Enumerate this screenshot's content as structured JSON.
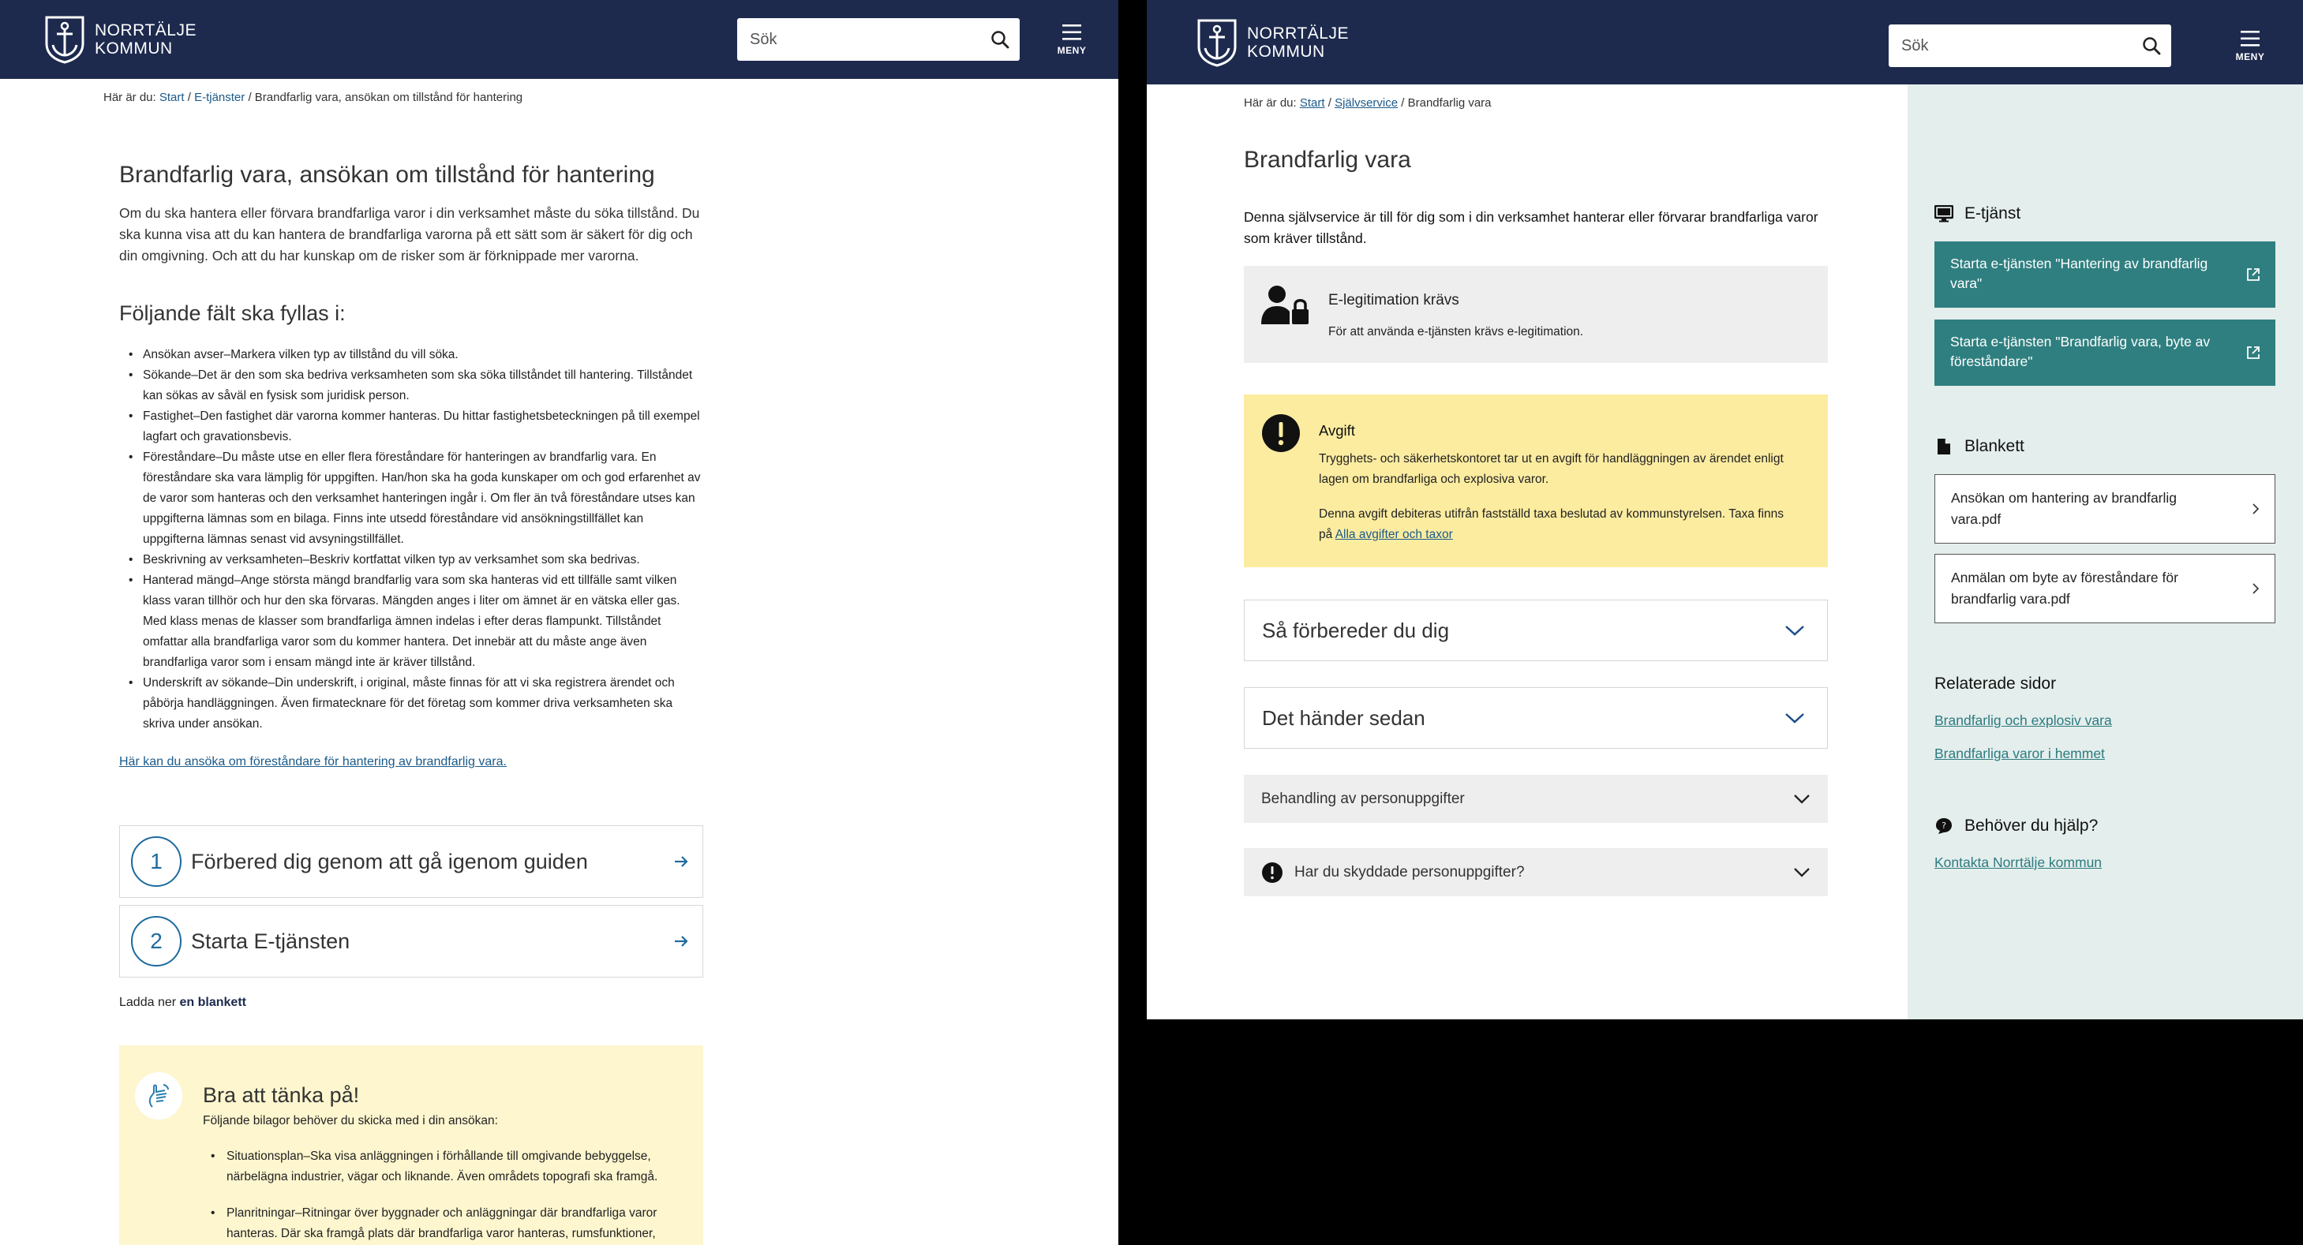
{
  "brand": {
    "line1": "NORRTÄLJE",
    "line2": "KOMMUN"
  },
  "search": {
    "placeholder": "Sök"
  },
  "menu": {
    "label": "MENY"
  },
  "left": {
    "breadcrumb": {
      "prefix": "Här är du:",
      "items": [
        "Start",
        "E-tjänster"
      ],
      "current": "Brandfarlig vara, ansökan om tillstånd för hantering"
    },
    "title": "Brandfarlig vara, ansökan om tillstånd för hantering",
    "intro": "Om du ska hantera eller förvara brandfarliga varor i din verksamhet måste du söka tillstånd. Du ska kunna visa att du kan hantera de brandfarliga varorna på ett sätt som är säkert för dig och din omgivning. Och att du har kunskap om de risker som är förknippade mer varorna.",
    "fields_heading": "Följande fält ska fyllas i:",
    "fields": [
      "Ansökan avser–Markera vilken typ av tillstånd du vill söka.",
      "Sökande–Det är den som ska bedriva verksamheten som ska söka tillståndet till hantering. Tillståndet kan sökas av såväl en fysisk som juridisk person.",
      "Fastighet–Den fastighet där varorna kommer hanteras. Du hittar fastighetsbeteckningen på till exempel lagfart och gravationsbevis.",
      "Föreståndare–Du måste utse en eller flera föreståndare för hanteringen av brandfarlig vara. En föreståndare ska vara lämplig för uppgiften. Han/hon ska ha goda kunskaper om och god erfarenhet av de varor som hanteras och den verksamhet hanteringen ingår i. Om fler än två föreståndare utses kan uppgifterna lämnas som en bilaga. Finns inte utsedd föreståndare vid ansökningstillfället kan uppgifterna lämnas senast vid avsyningstillfället.",
      "Beskrivning av verksamheten–Beskriv kortfattat vilken typ av verksamhet som ska bedrivas.",
      "Hanterad mängd–Ange största mängd brandfarlig vara som ska hanteras vid ett tillfälle samt vilken klass varan tillhör och hur den ska förvaras. Mängden anges i liter om ämnet är en vätska eller gas. Med klass menas de klasser som brandfarliga ämnen indelas i efter deras flampunkt. Tillståndet omfattar alla brandfarliga varor som du kommer hantera. Det innebär att du måste ange även brandfarliga varor som i ensam mängd inte är kräver tillstånd.",
      "Underskrift av sökande–Din underskrift, i original, måste finnas för att vi ska registrera ärendet och påbörja handläggningen. Även firmatecknare för det företag som kommer driva verksamheten ska skriva under ansökan."
    ],
    "manager_link": "Här kan du ansöka om föreståndare för hantering av brandfarlig vara.",
    "steps": [
      {
        "num": "1",
        "label": "Förbered dig genom att gå igenom guiden"
      },
      {
        "num": "2",
        "label": "Starta E-tjänsten"
      }
    ],
    "download": {
      "prefix": "Ladda ner",
      "link": "en blankett"
    },
    "tip": {
      "title": "Bra att tänka på!",
      "subtitle": "Följande bilagor behöver du skicka med i din ansökan:",
      "items": [
        "Situationsplan–Ska visa anläggningen i förhållande till omgivande bebyggelse, närbelägna industrier, vägar och liknande. Även områdets topografi ska framgå.",
        "Planritningar–Ritningar över byggnader och anläggningar där brandfarliga varor hanteras. Där ska framgå plats där brandfarliga varor hanteras, rumsfunktioner,"
      ]
    }
  },
  "right": {
    "breadcrumb": {
      "prefix": "Här är du:",
      "items": [
        "Start",
        "Självservice"
      ],
      "current": "Brandfarlig vara"
    },
    "title": "Brandfarlig vara",
    "intro": "Denna självservice är till för dig som i din verksamhet hanterar eller förvarar brandfarliga varor som kräver tillstånd.",
    "elegit": {
      "title": "E-legitimation krävs",
      "text": "För att använda e-tjänsten krävs e-legitimation."
    },
    "fee": {
      "title": "Avgift",
      "p1": "Trygghets- och säkerhetskontoret tar ut en avgift för handläggningen av ärendet enligt lagen om brandfarliga och explosiva varor.",
      "p2_prefix": "Denna avgift debiteras utifrån fastställd taxa beslutad av kommunstyrelsen. Taxa finns på",
      "p2_link": "Alla avgifter och taxor"
    },
    "accordions": [
      "Så förbereder du dig",
      "Det händer sedan"
    ],
    "accordions_small": [
      "Behandling av personuppgifter",
      "Har du skyddade personuppgifter?"
    ],
    "sidebar": {
      "eservice_heading": "E-tjänst",
      "eservices": [
        "Starta e-tjänsten \"Hantering av brandfarlig vara\"",
        "Starta e-tjänsten \"Brandfarlig vara, byte av föreståndare\""
      ],
      "forms_heading": "Blankett",
      "forms": [
        "Ansökan om hantering av brandfarlig vara.pdf",
        "Anmälan om byte av föreståndare för brandfarlig vara.pdf"
      ],
      "related_heading": "Relaterade sidor",
      "related": [
        "Brandfarlig och explosiv vara",
        "Brandfarliga varor i hemmet"
      ],
      "help_heading": "Behöver du hjälp?",
      "help_link": "Kontakta Norrtälje kommun"
    }
  }
}
